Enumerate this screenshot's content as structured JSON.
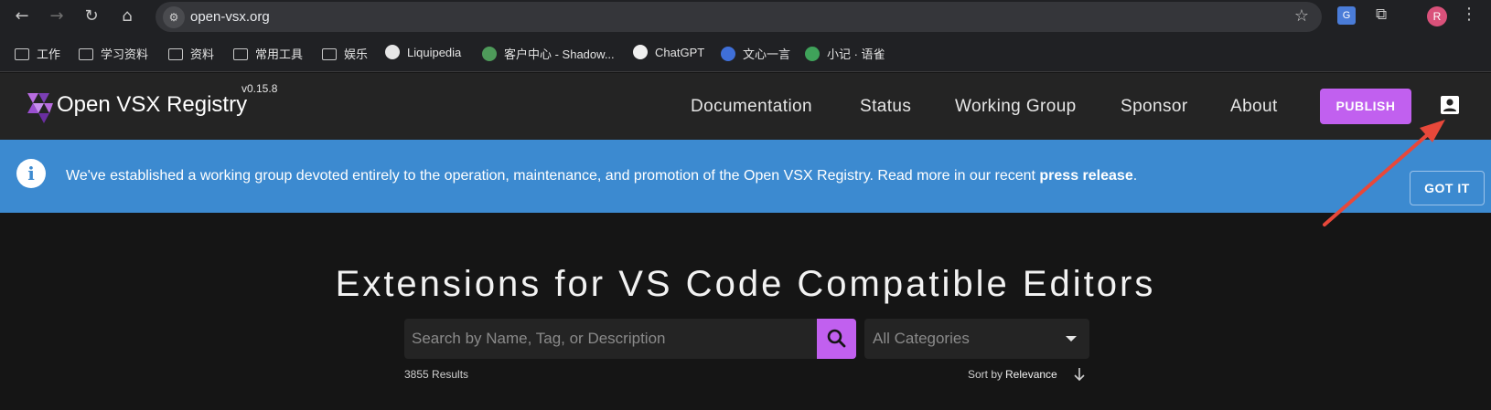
{
  "browser": {
    "url": "open-vsx.org",
    "profile_initial": "R",
    "icons": [
      "back-icon",
      "forward-icon",
      "reload-icon",
      "home-icon",
      "site-settings-icon",
      "star-icon",
      "translate-icon",
      "extensions-icon",
      "menu-icon"
    ]
  },
  "bookmarks": [
    {
      "label": "工作",
      "type": "folder"
    },
    {
      "label": "学习资料",
      "type": "folder"
    },
    {
      "label": "资料",
      "type": "folder"
    },
    {
      "label": "常用工具",
      "type": "folder"
    },
    {
      "label": "娱乐",
      "type": "folder"
    },
    {
      "label": "Liquipedia",
      "type": "site"
    },
    {
      "label": "客户中心 - Shadow...",
      "type": "site"
    },
    {
      "label": "ChatGPT",
      "type": "site"
    },
    {
      "label": "文心一言",
      "type": "site"
    },
    {
      "label": "小记 · 语雀",
      "type": "site"
    }
  ],
  "header": {
    "brand": "Open VSX Registry",
    "version": "v0.15.8",
    "nav": [
      "Documentation",
      "Status",
      "Working Group",
      "Sponsor",
      "About"
    ],
    "publish_label": "PUBLISH"
  },
  "banner": {
    "text": "We've established a working group devoted entirely to the operation, maintenance, and promotion of the Open VSX Registry. Read more in our recent ",
    "link": "press release",
    "suffix": ".",
    "dismiss_label": "GOT IT"
  },
  "main": {
    "headline": "Extensions for VS Code Compatible Editors",
    "search_placeholder": "Search by Name, Tag, or Description",
    "category_label": "All Categories",
    "results_count": "3855 Results",
    "sort_prefix": "Sort by",
    "sort_value": "Relevance"
  },
  "colors": {
    "accent": "#c160ef",
    "banner": "#3c8ad0",
    "annotation": "#e8483a"
  }
}
